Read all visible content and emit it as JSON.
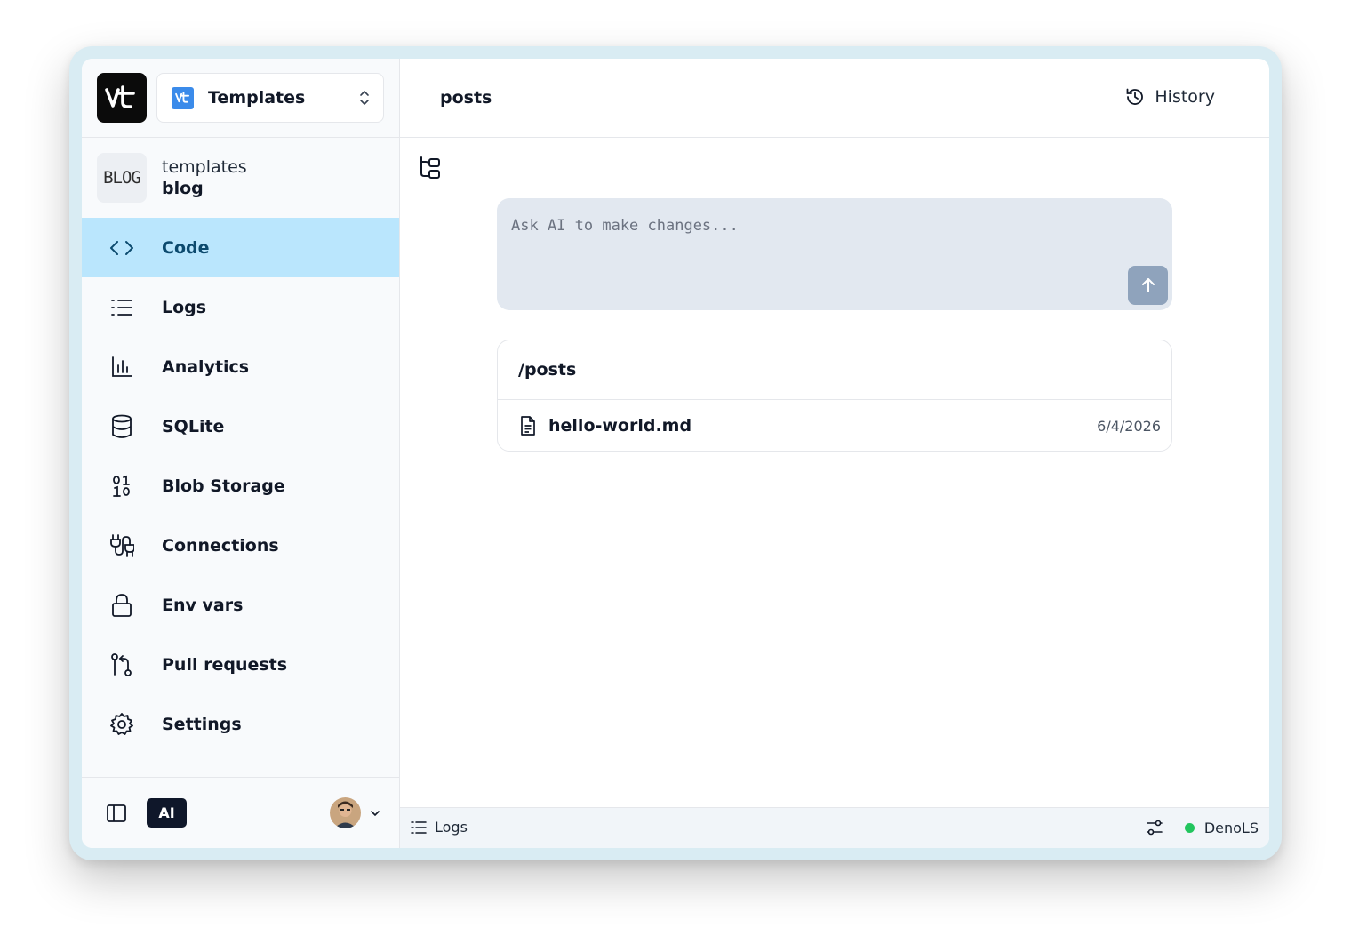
{
  "app": {
    "logo_text": "vt",
    "project_selector": {
      "label": "Templates",
      "icon": "vt-icon"
    }
  },
  "project": {
    "thumb_text": "BLOG",
    "owner": "templates",
    "name": "blog"
  },
  "sidebar": {
    "items": [
      {
        "label": "Code",
        "icon": "code-icon",
        "active": true
      },
      {
        "label": "Logs",
        "icon": "list-icon",
        "active": false
      },
      {
        "label": "Analytics",
        "icon": "bar-chart-icon",
        "active": false
      },
      {
        "label": "SQLite",
        "icon": "database-icon",
        "active": false
      },
      {
        "label": "Blob Storage",
        "icon": "binary-icon",
        "active": false
      },
      {
        "label": "Connections",
        "icon": "plug-icon",
        "active": false
      },
      {
        "label": "Env vars",
        "icon": "lock-icon",
        "active": false
      },
      {
        "label": "Pull requests",
        "icon": "git-pull-request-icon",
        "active": false
      },
      {
        "label": "Settings",
        "icon": "gear-icon",
        "active": false
      }
    ],
    "ai_label": "AI"
  },
  "header": {
    "title": "posts",
    "history_label": "History"
  },
  "ai_prompt": {
    "placeholder": "Ask AI to make changes..."
  },
  "files": {
    "folder": "/posts",
    "rows": [
      {
        "name": "hello-world.md",
        "date": "6/4/2026"
      }
    ]
  },
  "statusbar": {
    "logs_label": "Logs",
    "lsp_label": "DenoLS",
    "lsp_status_color": "#22c55e"
  },
  "colors": {
    "accent_active": "#bae6fd",
    "accent_active_text": "#0c4a6e",
    "vt_blue": "#3b8bea"
  }
}
